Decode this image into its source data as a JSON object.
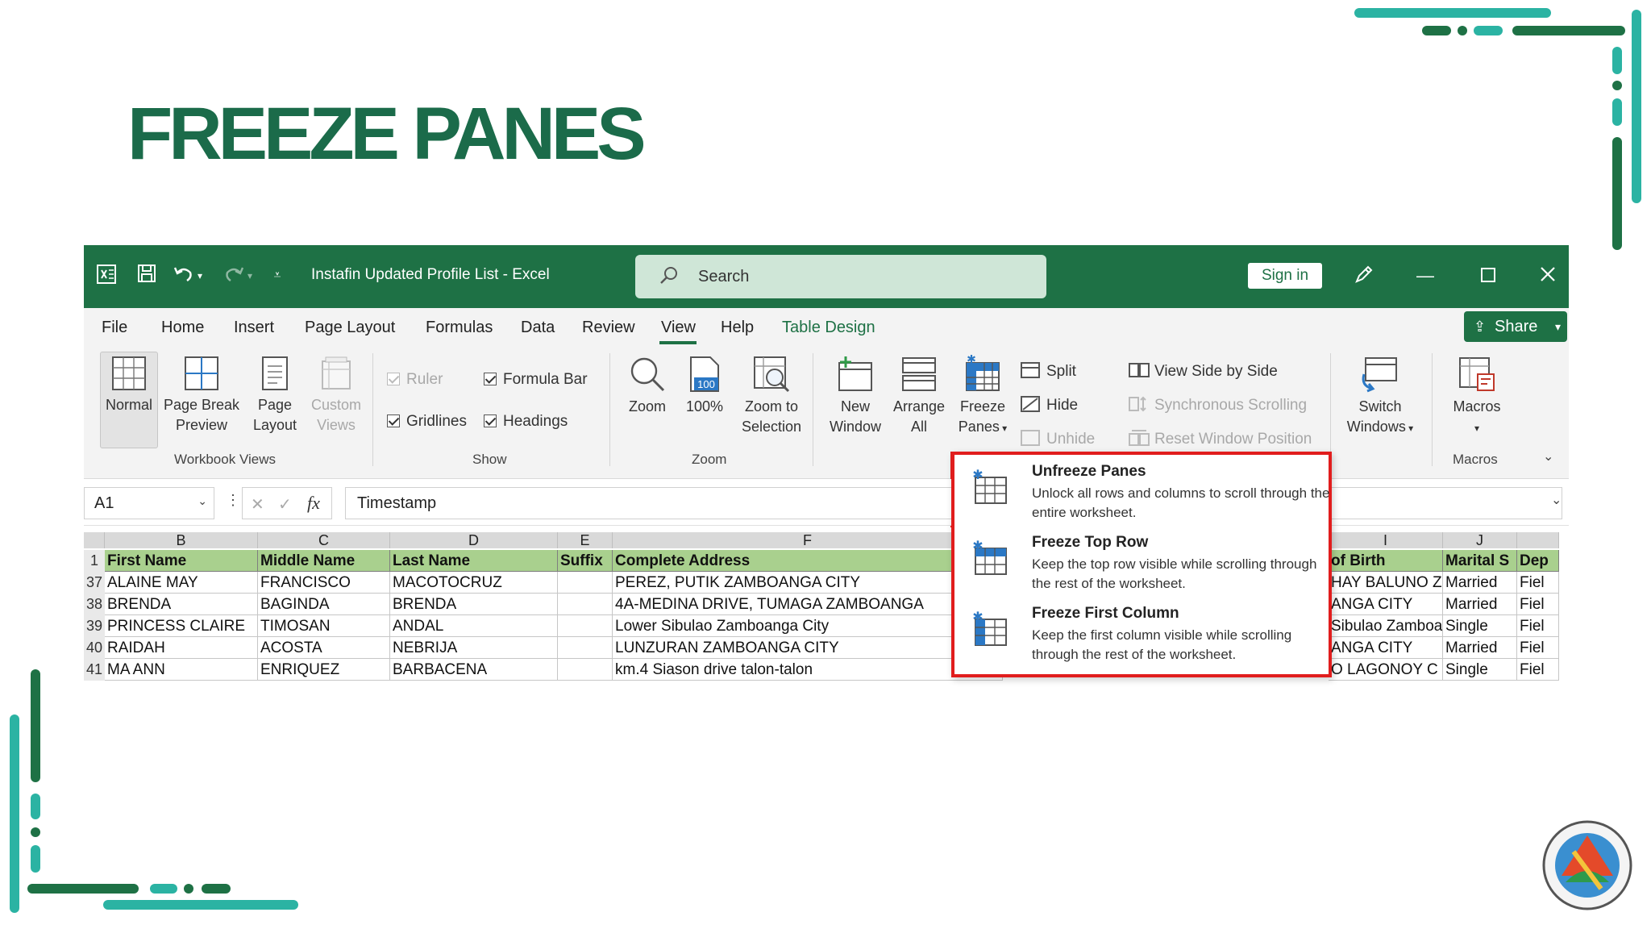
{
  "slide": {
    "title": "FREEZE PANES"
  },
  "colors": {
    "excel_green": "#1e7145",
    "title_green": "#1b6b4a",
    "highlight_red": "#e11d1d",
    "header_fill": "#a9d08e",
    "teal": "#2bb3a3"
  },
  "window": {
    "doc_title": "Instafin Updated Profile List  -  Excel",
    "search_placeholder": "Search",
    "sign_in": "Sign in",
    "share": "Share"
  },
  "menu": {
    "items": [
      "File",
      "Home",
      "Insert",
      "Page Layout",
      "Formulas",
      "Data",
      "Review",
      "View",
      "Help",
      "Table Design"
    ],
    "active": "View"
  },
  "ribbon": {
    "workbook_views": {
      "label": "Workbook Views",
      "normal": "Normal",
      "page_break_1": "Page Break",
      "page_break_2": "Preview",
      "page_layout_1": "Page",
      "page_layout_2": "Layout",
      "custom_1": "Custom",
      "custom_2": "Views"
    },
    "show": {
      "label": "Show",
      "ruler": "Ruler",
      "formula_bar": "Formula Bar",
      "gridlines": "Gridlines",
      "headings": "Headings"
    },
    "zoom": {
      "label": "Zoom",
      "zoom": "Zoom",
      "hundred": "100%",
      "hundred_icon": "100",
      "zoom_sel_1": "Zoom to",
      "zoom_sel_2": "Selection"
    },
    "window": {
      "new_1": "New",
      "new_2": "Window",
      "arrange_1": "Arrange",
      "arrange_2": "All",
      "freeze_1": "Freeze",
      "freeze_2": "Panes",
      "split": "Split",
      "hide": "Hide",
      "unhide": "Unhide",
      "side_by_side": "View Side by Side",
      "sync_scroll": "Synchronous Scrolling",
      "reset_pos": "Reset Window Position",
      "switch_1": "Switch",
      "switch_2": "Windows"
    },
    "macros": {
      "label": "Macros",
      "button": "Macros"
    }
  },
  "formula_bar": {
    "name_box": "A1",
    "fx": "fx",
    "value": "Timestamp"
  },
  "sheet": {
    "columns": [
      "B",
      "C",
      "D",
      "E",
      "F",
      "I",
      "J"
    ],
    "header": [
      "First Name",
      "Middle Name",
      "Last Name",
      "Suffix",
      "Complete Address",
      "of Birth",
      "Marital S",
      "Dep"
    ],
    "rows": [
      {
        "num": "37",
        "cells": [
          "ALAINE MAY",
          "FRANCISCO",
          "MACOTOCRUZ",
          "",
          "PEREZ, PUTIK ZAMBOANGA CITY",
          "HAY BALUNO Z",
          "Married",
          "Fiel"
        ]
      },
      {
        "num": "38",
        "cells": [
          "BRENDA",
          "BAGINDA",
          "BRENDA",
          "",
          "4A-MEDINA DRIVE, TUMAGA ZAMBOANGA",
          "ANGA CITY",
          "Married",
          "Fiel"
        ]
      },
      {
        "num": "39",
        "cells": [
          "PRINCESS CLAIRE",
          "TIMOSAN",
          "ANDAL",
          "",
          "Lower Sibulao Zamboanga City",
          "Sibulao Zamboa",
          "Single",
          "Fiel"
        ]
      },
      {
        "num": "40",
        "cells": [
          "RAIDAH",
          "ACOSTA",
          "NEBRIJA",
          "",
          "LUNZURAN ZAMBOANGA CITY",
          "ANGA CITY",
          "Married",
          "Fiel"
        ]
      },
      {
        "num": "41",
        "cells": [
          "MA ANN",
          "ENRIQUEZ",
          "BARBACENA",
          "",
          "km.4 Siason drive talon-talon",
          "O LAGONOY C",
          "Single",
          "Fiel"
        ]
      }
    ],
    "header_row_num": "1"
  },
  "freeze_menu": [
    {
      "title": "Unfreeze Panes",
      "desc": "Unlock all rows and columns to scroll through the entire worksheet."
    },
    {
      "title": "Freeze Top Row",
      "desc": "Keep the top row visible while scrolling through the rest of the worksheet."
    },
    {
      "title": "Freeze First Column",
      "desc": "Keep the first column visible while scrolling through the rest of the worksheet."
    }
  ]
}
